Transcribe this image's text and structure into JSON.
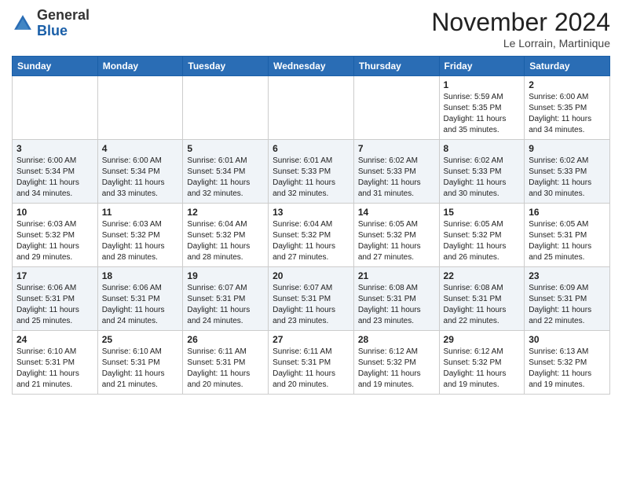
{
  "header": {
    "logo_line1": "General",
    "logo_line2": "Blue",
    "month": "November 2024",
    "location": "Le Lorrain, Martinique"
  },
  "days_of_week": [
    "Sunday",
    "Monday",
    "Tuesday",
    "Wednesday",
    "Thursday",
    "Friday",
    "Saturday"
  ],
  "weeks": [
    [
      {
        "day": null,
        "info": null
      },
      {
        "day": null,
        "info": null
      },
      {
        "day": null,
        "info": null
      },
      {
        "day": null,
        "info": null
      },
      {
        "day": null,
        "info": null
      },
      {
        "day": "1",
        "info": "Sunrise: 5:59 AM\nSunset: 5:35 PM\nDaylight: 11 hours\nand 35 minutes."
      },
      {
        "day": "2",
        "info": "Sunrise: 6:00 AM\nSunset: 5:35 PM\nDaylight: 11 hours\nand 34 minutes."
      }
    ],
    [
      {
        "day": "3",
        "info": "Sunrise: 6:00 AM\nSunset: 5:34 PM\nDaylight: 11 hours\nand 34 minutes."
      },
      {
        "day": "4",
        "info": "Sunrise: 6:00 AM\nSunset: 5:34 PM\nDaylight: 11 hours\nand 33 minutes."
      },
      {
        "day": "5",
        "info": "Sunrise: 6:01 AM\nSunset: 5:34 PM\nDaylight: 11 hours\nand 32 minutes."
      },
      {
        "day": "6",
        "info": "Sunrise: 6:01 AM\nSunset: 5:33 PM\nDaylight: 11 hours\nand 32 minutes."
      },
      {
        "day": "7",
        "info": "Sunrise: 6:02 AM\nSunset: 5:33 PM\nDaylight: 11 hours\nand 31 minutes."
      },
      {
        "day": "8",
        "info": "Sunrise: 6:02 AM\nSunset: 5:33 PM\nDaylight: 11 hours\nand 30 minutes."
      },
      {
        "day": "9",
        "info": "Sunrise: 6:02 AM\nSunset: 5:33 PM\nDaylight: 11 hours\nand 30 minutes."
      }
    ],
    [
      {
        "day": "10",
        "info": "Sunrise: 6:03 AM\nSunset: 5:32 PM\nDaylight: 11 hours\nand 29 minutes."
      },
      {
        "day": "11",
        "info": "Sunrise: 6:03 AM\nSunset: 5:32 PM\nDaylight: 11 hours\nand 28 minutes."
      },
      {
        "day": "12",
        "info": "Sunrise: 6:04 AM\nSunset: 5:32 PM\nDaylight: 11 hours\nand 28 minutes."
      },
      {
        "day": "13",
        "info": "Sunrise: 6:04 AM\nSunset: 5:32 PM\nDaylight: 11 hours\nand 27 minutes."
      },
      {
        "day": "14",
        "info": "Sunrise: 6:05 AM\nSunset: 5:32 PM\nDaylight: 11 hours\nand 27 minutes."
      },
      {
        "day": "15",
        "info": "Sunrise: 6:05 AM\nSunset: 5:32 PM\nDaylight: 11 hours\nand 26 minutes."
      },
      {
        "day": "16",
        "info": "Sunrise: 6:05 AM\nSunset: 5:31 PM\nDaylight: 11 hours\nand 25 minutes."
      }
    ],
    [
      {
        "day": "17",
        "info": "Sunrise: 6:06 AM\nSunset: 5:31 PM\nDaylight: 11 hours\nand 25 minutes."
      },
      {
        "day": "18",
        "info": "Sunrise: 6:06 AM\nSunset: 5:31 PM\nDaylight: 11 hours\nand 24 minutes."
      },
      {
        "day": "19",
        "info": "Sunrise: 6:07 AM\nSunset: 5:31 PM\nDaylight: 11 hours\nand 24 minutes."
      },
      {
        "day": "20",
        "info": "Sunrise: 6:07 AM\nSunset: 5:31 PM\nDaylight: 11 hours\nand 23 minutes."
      },
      {
        "day": "21",
        "info": "Sunrise: 6:08 AM\nSunset: 5:31 PM\nDaylight: 11 hours\nand 23 minutes."
      },
      {
        "day": "22",
        "info": "Sunrise: 6:08 AM\nSunset: 5:31 PM\nDaylight: 11 hours\nand 22 minutes."
      },
      {
        "day": "23",
        "info": "Sunrise: 6:09 AM\nSunset: 5:31 PM\nDaylight: 11 hours\nand 22 minutes."
      }
    ],
    [
      {
        "day": "24",
        "info": "Sunrise: 6:10 AM\nSunset: 5:31 PM\nDaylight: 11 hours\nand 21 minutes."
      },
      {
        "day": "25",
        "info": "Sunrise: 6:10 AM\nSunset: 5:31 PM\nDaylight: 11 hours\nand 21 minutes."
      },
      {
        "day": "26",
        "info": "Sunrise: 6:11 AM\nSunset: 5:31 PM\nDaylight: 11 hours\nand 20 minutes."
      },
      {
        "day": "27",
        "info": "Sunrise: 6:11 AM\nSunset: 5:31 PM\nDaylight: 11 hours\nand 20 minutes."
      },
      {
        "day": "28",
        "info": "Sunrise: 6:12 AM\nSunset: 5:32 PM\nDaylight: 11 hours\nand 19 minutes."
      },
      {
        "day": "29",
        "info": "Sunrise: 6:12 AM\nSunset: 5:32 PM\nDaylight: 11 hours\nand 19 minutes."
      },
      {
        "day": "30",
        "info": "Sunrise: 6:13 AM\nSunset: 5:32 PM\nDaylight: 11 hours\nand 19 minutes."
      }
    ]
  ]
}
